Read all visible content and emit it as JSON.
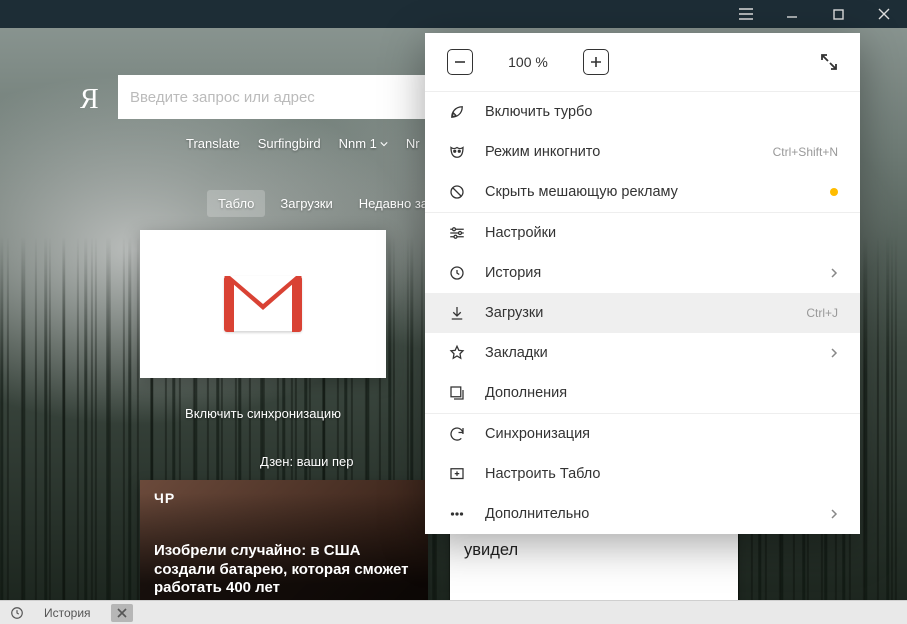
{
  "titlebar": {
    "tooltip_menu": "menu"
  },
  "search": {
    "placeholder": "Введите запрос или адрес",
    "logo": "Я"
  },
  "quicklinks": [
    "Translate",
    "Surfingbird",
    "Nnm 1",
    "Nr"
  ],
  "tabs": {
    "tablo": "Табло",
    "downloads": "Загрузки",
    "recent": "Недавно за"
  },
  "tile": {
    "caption": "Включить синхронизацию"
  },
  "zen": {
    "heading": "Дзен: ваши пер"
  },
  "cards": {
    "c1_brand": "ЧР",
    "c1_text": "Изобрели случайно: в США создали батарею, которая сможет работать 400 лет",
    "c2_text": "Этот парень попал в первый класс самолета. И вот что он там увидел"
  },
  "menu": {
    "zoom": "100 %",
    "turbo": "Включить турбо",
    "incognito": "Режим инкогнито",
    "incognito_shortcut": "Ctrl+Shift+N",
    "hide_ads": "Скрыть мешающую рекламу",
    "settings": "Настройки",
    "history": "История",
    "downloads": "Загрузки",
    "downloads_shortcut": "Ctrl+J",
    "bookmarks": "Закладки",
    "addons": "Дополнения",
    "sync": "Синхронизация",
    "configure_tablo": "Настроить Табло",
    "more": "Дополнительно"
  },
  "statusbar": {
    "history": "История"
  }
}
